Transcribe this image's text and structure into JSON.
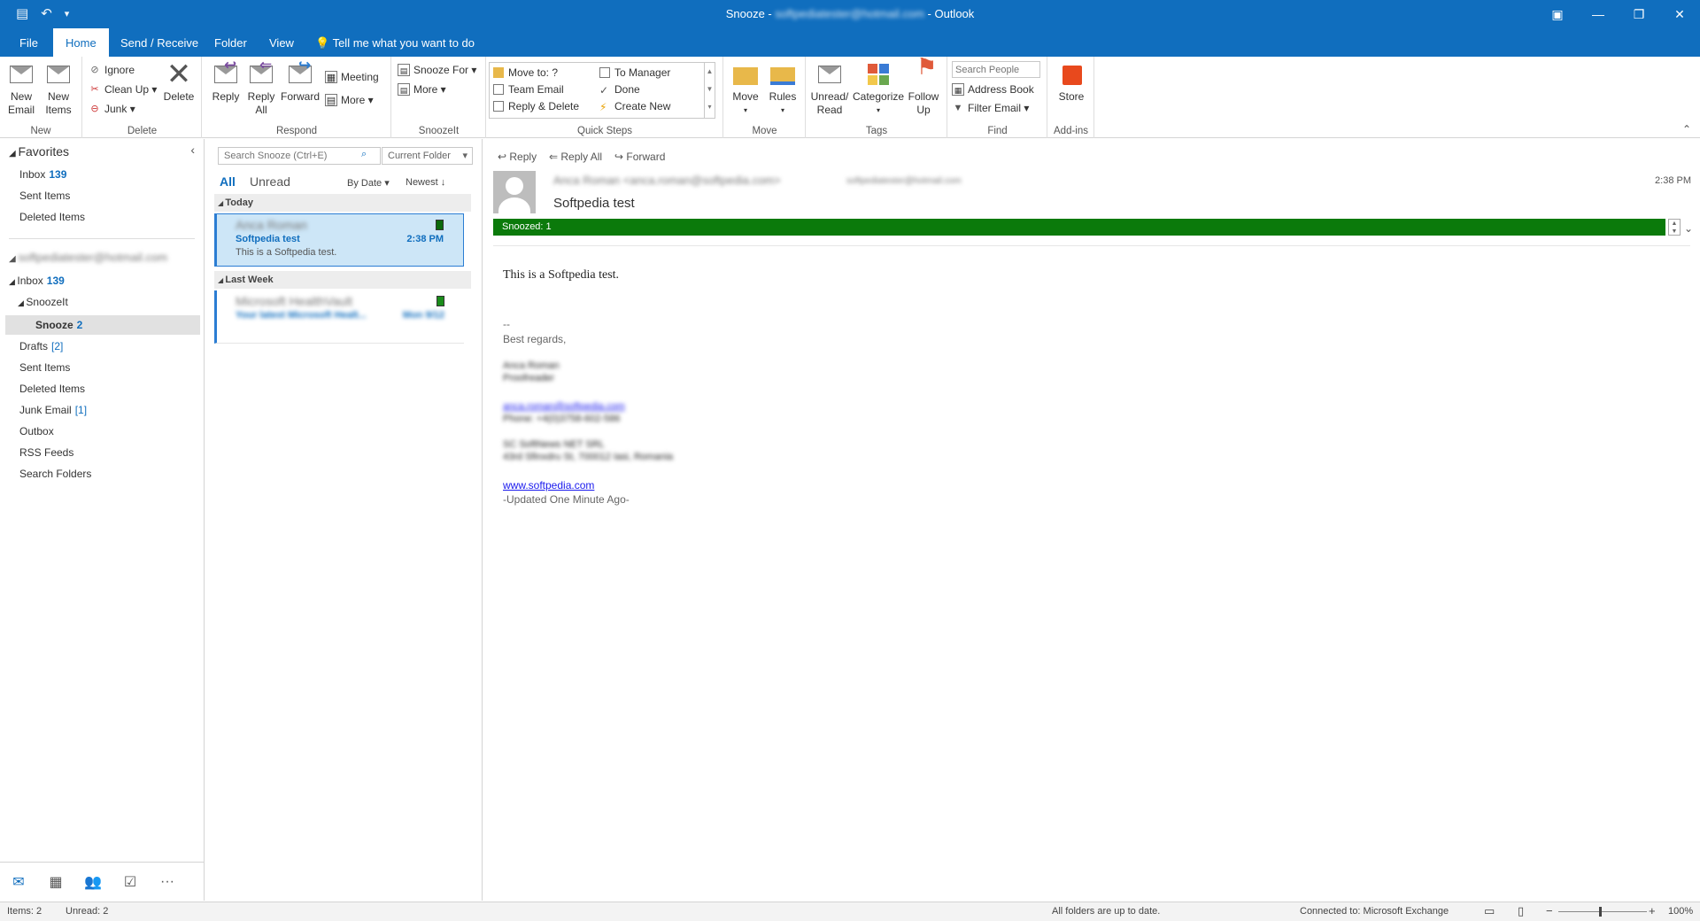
{
  "titlebar": {
    "title_prefix": "Snooze - ",
    "title_account": "softpediatester@hotmail.com",
    "title_suffix": " - Outlook"
  },
  "menu": {
    "file": "File",
    "home": "Home",
    "send_receive": "Send / Receive",
    "folder": "Folder",
    "view": "View",
    "tell_me": "Tell me what you want to do"
  },
  "ribbon": {
    "new_group": {
      "label": "New",
      "new_email": "New\nEmail",
      "new_items": "New\nItems"
    },
    "delete_group": {
      "label": "Delete",
      "ignore": "Ignore",
      "clean_up": "Clean Up",
      "junk": "Junk",
      "delete": "Delete"
    },
    "respond_group": {
      "label": "Respond",
      "reply": "Reply",
      "reply_all": "Reply\nAll",
      "forward": "Forward",
      "meeting": "Meeting",
      "more": "More"
    },
    "snoozeit_group": {
      "label": "SnoozeIt",
      "snooze_for": "Snooze For",
      "more": "More"
    },
    "quicksteps_group": {
      "label": "Quick Steps",
      "move_to": "Move to: ?",
      "team_email": "Team Email",
      "reply_delete": "Reply & Delete",
      "to_manager": "To Manager",
      "done": "Done",
      "create_new": "Create New"
    },
    "move_group": {
      "label": "Move",
      "move": "Move",
      "rules": "Rules"
    },
    "tags_group": {
      "label": "Tags",
      "unread_read": "Unread/\nRead",
      "categorize": "Categorize",
      "follow_up": "Follow\nUp"
    },
    "find_group": {
      "label": "Find",
      "search_people_placeholder": "Search People",
      "address_book": "Address Book",
      "filter_email": "Filter Email"
    },
    "addins_group": {
      "label": "Add-ins",
      "store": "Store"
    }
  },
  "nav": {
    "favorites": "Favorites",
    "fav_inbox": "Inbox",
    "fav_inbox_count": "139",
    "fav_sent": "Sent Items",
    "fav_deleted": "Deleted Items",
    "account": "softpediatester@hotmail.com",
    "inbox": "Inbox",
    "inbox_count": "139",
    "snoozeit": "SnoozeIt",
    "snooze": "Snooze",
    "snooze_count": "2",
    "drafts": "Drafts",
    "drafts_count": "[2]",
    "sent": "Sent Items",
    "deleted": "Deleted Items",
    "junk": "Junk Email",
    "junk_count": "[1]",
    "outbox": "Outbox",
    "rss": "RSS Feeds",
    "search_folders": "Search Folders"
  },
  "list": {
    "search_placeholder": "Search Snooze (Ctrl+E)",
    "scope": "Current Folder",
    "filter_all": "All",
    "filter_unread": "Unread",
    "sort_by": "By Date",
    "sort_order": "Newest",
    "section_today": "Today",
    "section_last_week": "Last Week",
    "messages": [
      {
        "from": "Anca Roman",
        "subject": "Softpedia test",
        "preview": "This is a Softpedia test.",
        "time": "2:38 PM"
      },
      {
        "from": "Microsoft HealthVault",
        "subject": "Your latest Microsoft Healt...",
        "preview": "",
        "time": "Mon 9/12"
      }
    ]
  },
  "reading": {
    "reply": "Reply",
    "reply_all": "Reply All",
    "forward": "Forward",
    "from": "Anca Roman <anca.roman@softpedia.com>",
    "to": "softpediatester@hotmail.com",
    "time": "2:38 PM",
    "subject": "Softpedia test",
    "snoozed": "Snoozed:   1",
    "body_line": "This is a Softpedia test.",
    "sig_dash": "--",
    "sig_regards": "Best regards,",
    "sig_name": "Anca Roman",
    "sig_role": "Proofreader",
    "sig_email": "anca.roman@softpedia.com",
    "sig_phone": "Phone: +4(0)3758-602-586",
    "sig_company": "SC SoftNews NET SRL",
    "sig_address": "43rd Sfinxdru St, 700012 Iasi, Romania",
    "sig_web": "www.softpedia.com",
    "sig_updated": "-Updated One Minute Ago-"
  },
  "status": {
    "items": "Items: 2",
    "unread": "Unread: 2",
    "sync": "All folders are up to date.",
    "connection": "Connected to: Microsoft Exchange",
    "zoom": "100%"
  }
}
